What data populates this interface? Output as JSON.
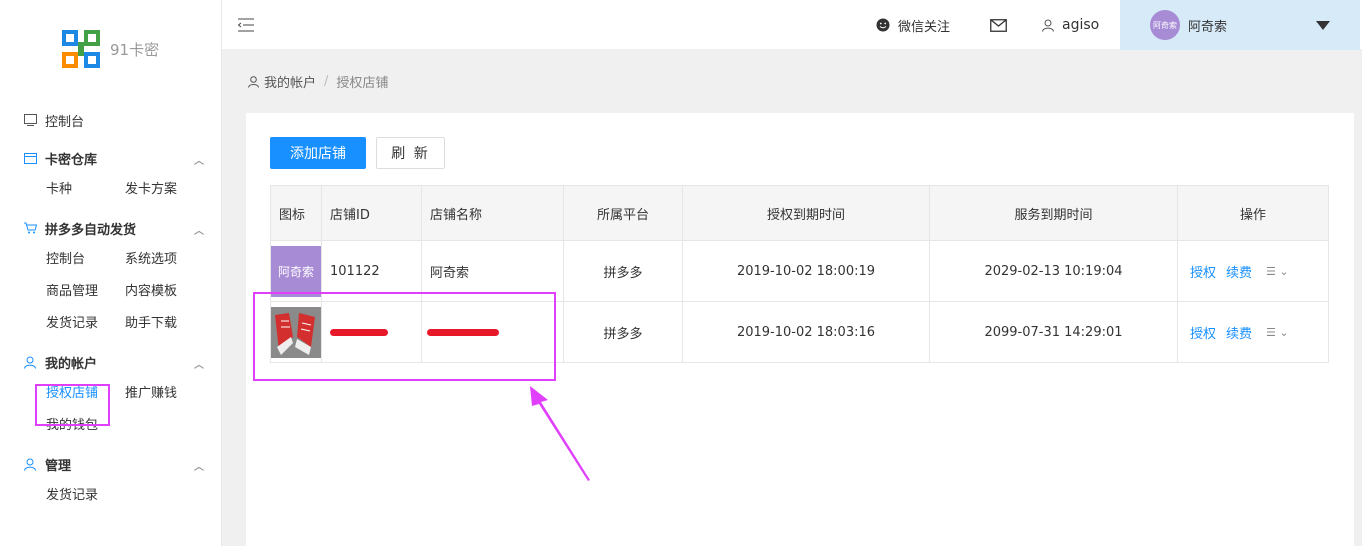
{
  "app": {
    "name": "91卡密"
  },
  "sidebar": {
    "console": "控制台",
    "groups": [
      {
        "title": "卡密仓库",
        "items": [
          "卡种",
          "发卡方案"
        ]
      },
      {
        "title": "拼多多自动发货",
        "items": [
          "控制台",
          "系统选项",
          "商品管理",
          "内容模板",
          "发货记录",
          "助手下载"
        ]
      },
      {
        "title": "我的帐户",
        "items": [
          "授权店铺",
          "推广赚钱",
          "我的钱包"
        ]
      },
      {
        "title": "管理",
        "items": [
          "发货记录"
        ]
      }
    ]
  },
  "topbar": {
    "wechat": "微信关注",
    "username": "agiso",
    "avatar_text": "阿奇索",
    "user_display": "阿奇索"
  },
  "breadcrumb": {
    "root": "我的帐户",
    "sep": "/",
    "current": "授权店铺"
  },
  "toolbar": {
    "add_label": "添加店铺",
    "refresh_label": "刷 新"
  },
  "table": {
    "headers": [
      "图标",
      "店铺ID",
      "店铺名称",
      "所属平台",
      "授权到期时间",
      "服务到期时间",
      "操作"
    ],
    "rows": [
      {
        "icon_text": "阿奇索",
        "id": "101122",
        "name": "阿奇索",
        "platform": "拼多多",
        "auth_expire": "2019-10-02 18:00:19",
        "service_expire": "2029-02-13 10:19:04",
        "op_auth": "授权",
        "op_renew": "续费"
      },
      {
        "icon_text": "",
        "id": "",
        "name": "",
        "platform": "拼多多",
        "auth_expire": "2019-10-02 18:03:16",
        "service_expire": "2099-07-31 14:29:01",
        "op_auth": "授权",
        "op_renew": "续费"
      }
    ]
  },
  "colors": {
    "primary": "#1890ff",
    "annotation": "#e040fb",
    "avatar": "#a78bd4"
  }
}
